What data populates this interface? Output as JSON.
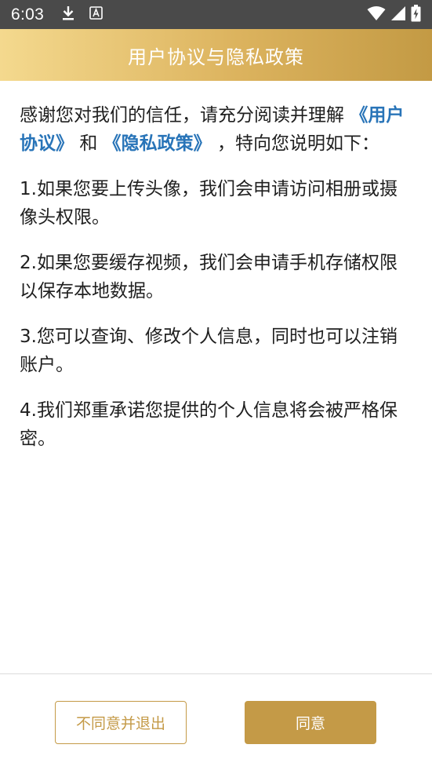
{
  "status_bar": {
    "time": "6:03",
    "icons": [
      "download-icon",
      "keyboard-a-icon",
      "wifi-icon",
      "signal-icon",
      "battery-charging-icon"
    ]
  },
  "header": {
    "title": "用户协议与隐私政策"
  },
  "content": {
    "intro_prefix": "感谢您对我们的信任，请充分阅读并理解",
    "user_agreement_link": "《用户协议》",
    "and_text": "和",
    "privacy_policy_link": "《隐私政策》",
    "intro_suffix": "，特向您说明如下：",
    "items": [
      "1.如果您要上传头像，我们会申请访问相册或摄像头权限。",
      "2.如果您要缓存视频，我们会申请手机存储权限以保存本地数据。",
      "3.您可以查询、修改个人信息，同时也可以注销账户。",
      "4.我们郑重承诺您提供的个人信息将会被严格保密。"
    ]
  },
  "footer": {
    "disagree_label": "不同意并退出",
    "agree_label": "同意"
  },
  "colors": {
    "accent": "#c49a47",
    "link": "#2874b8",
    "status_bar": "#4a4a4a"
  }
}
